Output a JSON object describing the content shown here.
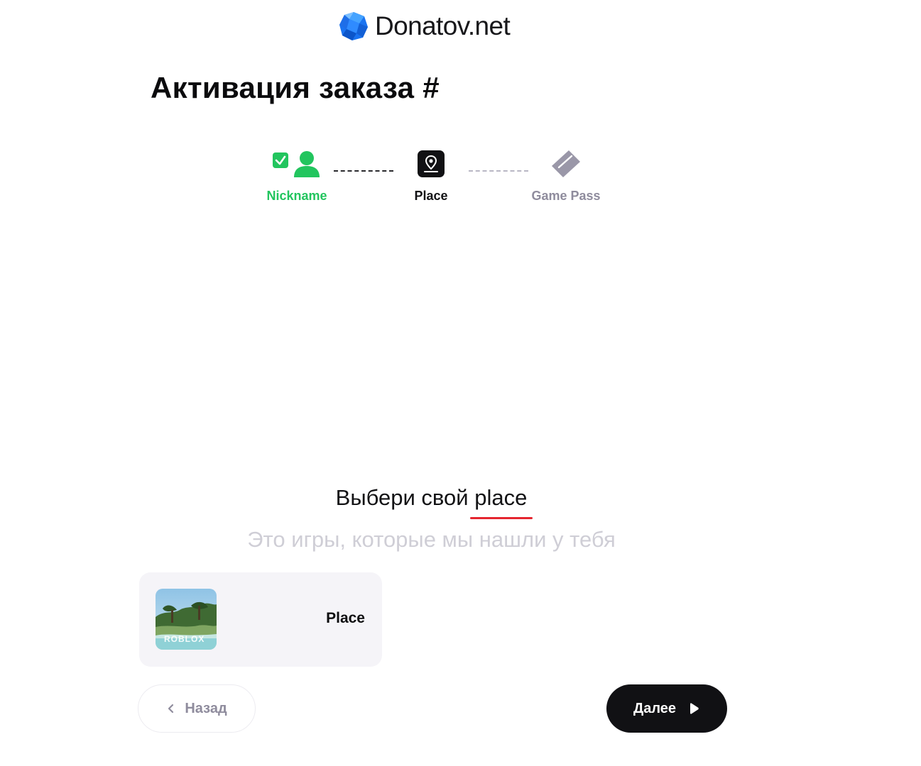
{
  "brand": {
    "name": "Donatov.net"
  },
  "page": {
    "title": "Активация заказа #"
  },
  "steps": [
    {
      "label": "Nickname",
      "state": "completed",
      "icon": "user-icon"
    },
    {
      "label": "Place",
      "state": "active",
      "icon": "map-pin-icon"
    },
    {
      "label": "Game Pass",
      "state": "pending",
      "icon": "ticket-icon"
    }
  ],
  "section": {
    "heading_prefix": "Выбери свой",
    "heading_highlight": "place",
    "subheading": "Это игры, которые мы нашли у тебя"
  },
  "places": [
    {
      "name": "Place",
      "thumbnail_text": "ROBLOX"
    }
  ],
  "nav": {
    "back_label": "Назад",
    "next_label": "Далее"
  },
  "colors": {
    "completed": "#22c55e",
    "active": "#111114",
    "pending": "#8f8c9d",
    "accent_underline": "#e5262f",
    "button_primary": "#111114",
    "card_background": "#f5f4f8",
    "logo_blue": "#1a73f0"
  }
}
